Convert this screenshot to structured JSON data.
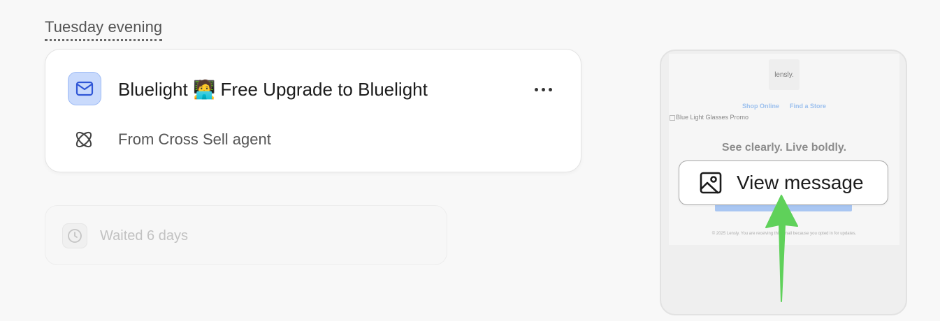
{
  "timeline": {
    "day_label": "Tuesday evening"
  },
  "email_card": {
    "icon": "mail-icon",
    "title": "Bluelight 🧑‍💻 Free Upgrade to Bluelight",
    "more_icon": "more-horizontal-icon",
    "agent_icon": "atom-icon",
    "agent_text": "From Cross Sell agent"
  },
  "wait_card": {
    "icon": "clock-icon",
    "text": "Waited 6 days"
  },
  "preview": {
    "brand": "lensly.",
    "nav_links": [
      "Shop Online",
      "Find a Store"
    ],
    "promo_alt": "Blue Light Glasses Promo",
    "tagline": "See clearly. Live boldly.",
    "footer": "© 2025 Lensly. You are receiving this email because you opted in for updates.",
    "view_button_label": "View message",
    "view_button_icon": "image-icon"
  },
  "annotation": {
    "arrow_color": "#5fd15a"
  }
}
